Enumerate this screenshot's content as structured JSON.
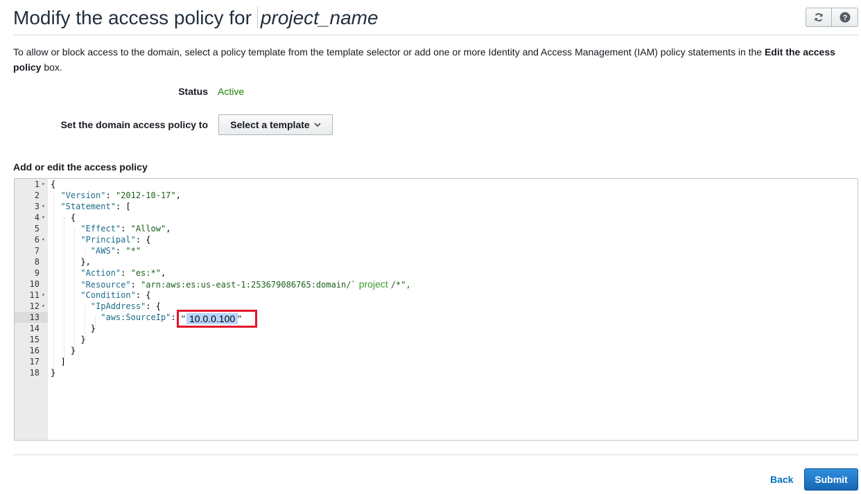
{
  "header": {
    "title_prefix": "Modify the access policy for",
    "project_name": "project_name",
    "refresh_icon": "refresh-icon",
    "help_icon": "help-icon"
  },
  "description": {
    "text_before": "To allow or block access to the domain, select a policy template from the template selector or add one or more Identity and Access Management (IAM) policy statements in the ",
    "bold": "Edit the access policy",
    "text_after": " box."
  },
  "status": {
    "label": "Status",
    "value": "Active",
    "color": "#1d8102"
  },
  "template": {
    "label": "Set the domain access policy to",
    "button_label": "Select a template",
    "chevron_icon": "chevron-down-icon"
  },
  "editor": {
    "section_label": "Add or edit the access policy",
    "lines": [
      {
        "num": "1",
        "fold": true
      },
      {
        "num": "2",
        "key": "\"Version\"",
        "value": "\"2012-10-17\"",
        "tail": ","
      },
      {
        "num": "3",
        "fold": true,
        "key": "\"Statement\"",
        "tail": ": ["
      },
      {
        "num": "4",
        "fold": true
      },
      {
        "num": "5",
        "key": "\"Effect\"",
        "value": "\"Allow\"",
        "tail": ","
      },
      {
        "num": "6",
        "fold": true,
        "key": "\"Principal\"",
        "tail": ": {"
      },
      {
        "num": "7",
        "key": "\"AWS\"",
        "value": "\"*\""
      },
      {
        "num": "8"
      },
      {
        "num": "9",
        "key": "\"Action\"",
        "value": "\"es:*\"",
        "tail": ","
      },
      {
        "num": "10",
        "key": "\"Resource\"",
        "value": "\"arn:aws:es:us-east-1:253679086765:domain/`",
        "project": "project",
        "after_project": "/*\","
      },
      {
        "num": "11",
        "fold": true,
        "key": "\"Condition\"",
        "tail": ": {"
      },
      {
        "num": "12",
        "fold": true,
        "key": "\"IpAddress\"",
        "tail": ": {"
      },
      {
        "num": "13",
        "key": "\"aws:SourceIp\"",
        "ip": "10.0.0.100",
        "active": true
      },
      {
        "num": "14"
      },
      {
        "num": "15"
      },
      {
        "num": "16"
      },
      {
        "num": "17"
      },
      {
        "num": "18"
      }
    ]
  },
  "footer": {
    "back_label": "Back",
    "submit_label": "Submit"
  }
}
